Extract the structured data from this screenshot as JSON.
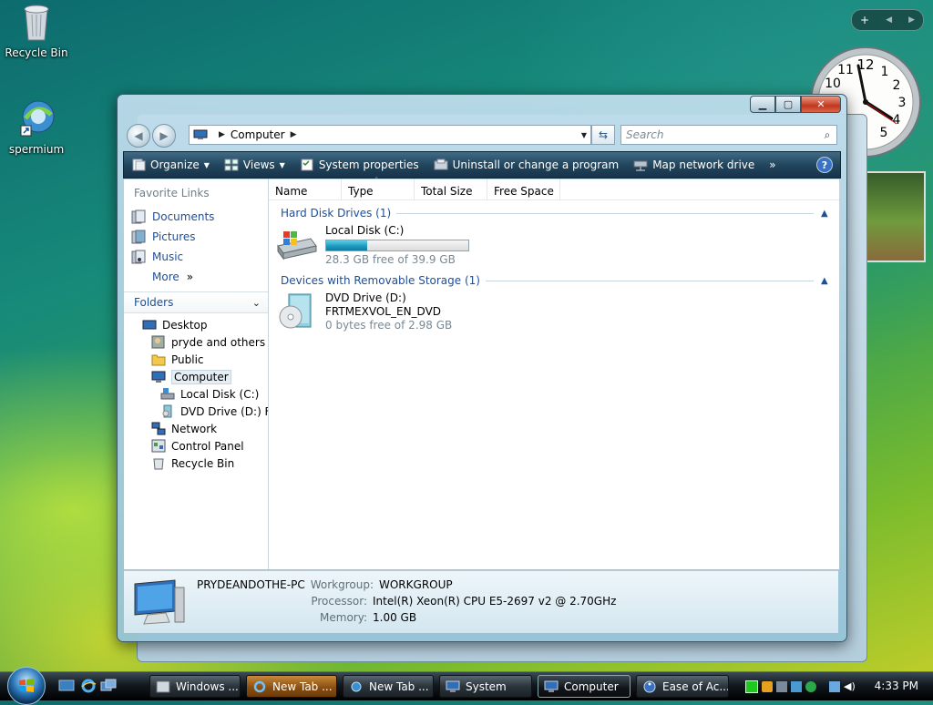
{
  "desktop": {
    "icons": [
      {
        "label": "Recycle Bin"
      },
      {
        "label": "spermium"
      }
    ]
  },
  "window": {
    "address": {
      "path": "Computer"
    },
    "search": {
      "placeholder": "Search"
    },
    "toolbar": {
      "organize": "Organize",
      "views": "Views",
      "system_properties": "System properties",
      "uninstall": "Uninstall or change a program",
      "map_drive": "Map network drive",
      "more": "»",
      "help": "?"
    },
    "nav": {
      "favorite_links_title": "Favorite Links",
      "favorites": [
        "Documents",
        "Pictures",
        "Music"
      ],
      "more_label": "More",
      "more_chevron": "»",
      "folders_title": "Folders",
      "tree": [
        {
          "label": "Desktop",
          "level": 0
        },
        {
          "label": "pryde and others",
          "level": 1
        },
        {
          "label": "Public",
          "level": 1
        },
        {
          "label": "Computer",
          "level": 1
        },
        {
          "label": "Local Disk (C:)",
          "level": 2
        },
        {
          "label": "DVD Drive (D:) FRTMEXVOL_EN_DVD",
          "level": 2
        },
        {
          "label": "Network",
          "level": 1
        },
        {
          "label": "Control Panel",
          "level": 1
        },
        {
          "label": "Recycle Bin",
          "level": 1
        }
      ]
    },
    "columns": [
      "Name",
      "Type",
      "Total Size",
      "Free Space"
    ],
    "groups": {
      "hard_disk": "Hard Disk Drives (1)",
      "removable": "Devices with Removable Storage (1)"
    },
    "drives": {
      "c": {
        "name": "Local Disk (C:)",
        "free_text": "28.3 GB free of 39.9 GB",
        "used_fraction": 0.29
      },
      "d": {
        "name": "DVD Drive (D:)",
        "label": "FRTMEXVOL_EN_DVD",
        "free_text": "0 bytes free of 2.98 GB"
      }
    },
    "details": {
      "computer_name": "PRYDEANDOTHE-PC",
      "workgroup_label": "Workgroup:",
      "workgroup": "WORKGROUP",
      "processor_label": "Processor:",
      "processor": "Intel(R) Xeon(R) CPU E5-2697 v2 @ 2.70GHz",
      "memory_label": "Memory:",
      "memory": "1.00 GB"
    }
  },
  "sidebar": {
    "clock_numbers": [
      "12",
      "1",
      "2",
      "3",
      "4",
      "5",
      "10",
      "11"
    ]
  },
  "taskbar": {
    "buttons": [
      {
        "label": "Windows ..."
      },
      {
        "label": "New Tab ..."
      },
      {
        "label": "New Tab ..."
      },
      {
        "label": "System"
      },
      {
        "label": "Computer"
      },
      {
        "label": "Ease of Ac..."
      }
    ],
    "clock": "4:33 PM"
  }
}
